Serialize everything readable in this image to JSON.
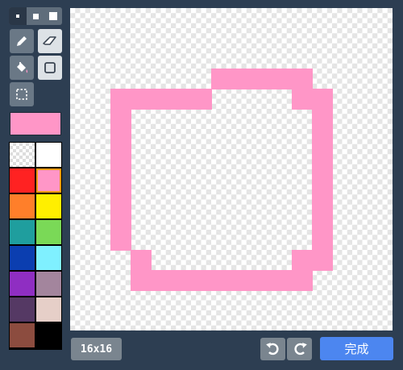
{
  "brush_sizes": [
    "small",
    "medium",
    "large"
  ],
  "selected_brush_size": "small",
  "tools": [
    "pencil",
    "eraser",
    "fill",
    "rectangle",
    "select"
  ],
  "selected_tool": "pencil",
  "current_color": "#ff96c7",
  "palette": [
    "transparent",
    "#ffffff",
    "#ff2222",
    "#ff96c7",
    "#ff7f2a",
    "#ffef00",
    "#1f9e9e",
    "#7ad957",
    "#0b3eb0",
    "#7ff0ff",
    "#8f2ec2",
    "#a3859d",
    "#553964",
    "#e6cfc8",
    "#8c4c3f",
    "#000000"
  ],
  "canvas": {
    "grid": "16x16",
    "pixel_color": "#ff96c7",
    "filled_pixels": [
      [
        7,
        3
      ],
      [
        8,
        3
      ],
      [
        9,
        3
      ],
      [
        10,
        3
      ],
      [
        11,
        3
      ],
      [
        2,
        4
      ],
      [
        3,
        4
      ],
      [
        4,
        4
      ],
      [
        5,
        4
      ],
      [
        6,
        4
      ],
      [
        11,
        4
      ],
      [
        12,
        4
      ],
      [
        2,
        5
      ],
      [
        12,
        5
      ],
      [
        2,
        6
      ],
      [
        12,
        6
      ],
      [
        2,
        7
      ],
      [
        12,
        7
      ],
      [
        2,
        8
      ],
      [
        12,
        8
      ],
      [
        2,
        9
      ],
      [
        12,
        9
      ],
      [
        2,
        10
      ],
      [
        12,
        10
      ],
      [
        2,
        11
      ],
      [
        12,
        11
      ],
      [
        3,
        12
      ],
      [
        11,
        12
      ],
      [
        12,
        12
      ],
      [
        3,
        13
      ],
      [
        4,
        13
      ],
      [
        5,
        13
      ],
      [
        6,
        13
      ],
      [
        7,
        13
      ],
      [
        8,
        13
      ],
      [
        9,
        13
      ],
      [
        10,
        13
      ],
      [
        11,
        13
      ]
    ]
  },
  "footer": {
    "size_label": "16x16",
    "undo_icon": "undo-icon",
    "redo_icon": "redo-icon",
    "done_label": "完成"
  }
}
